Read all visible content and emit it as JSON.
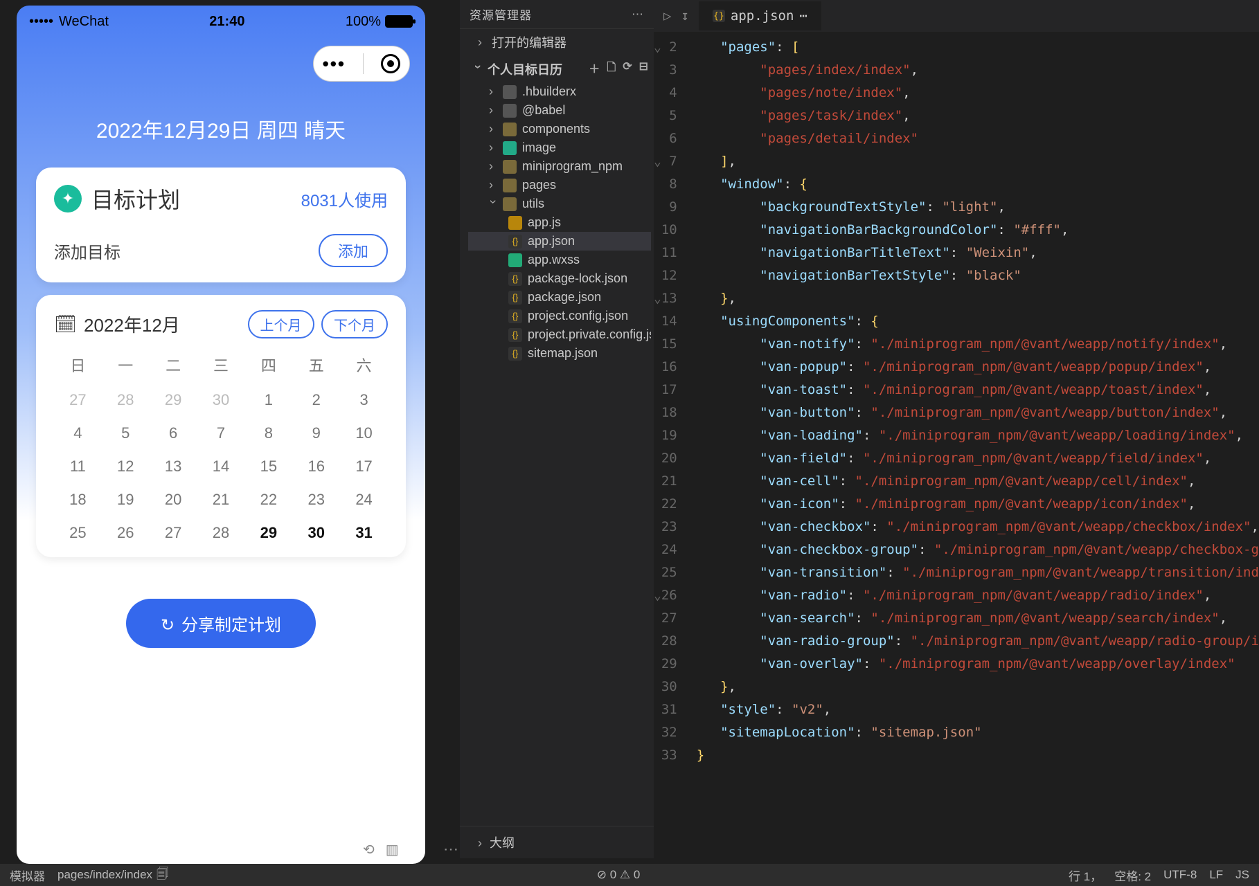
{
  "phone": {
    "status_bar": {
      "signal": "•••••",
      "carrier": "WeChat",
      "time": "21:40",
      "battery": "100%"
    },
    "capsule": {
      "dots": "•••"
    },
    "headline": "2022年12月29日 周四 晴天",
    "goal_card": {
      "title": "目标计划",
      "usage": "8031人使用",
      "add_label": "添加目标",
      "add_btn": "添加"
    },
    "calendar": {
      "title": "2022年12月",
      "prev": "上个月",
      "next": "下个月",
      "dow": [
        "日",
        "一",
        "二",
        "三",
        "四",
        "五",
        "六"
      ],
      "weeks": [
        [
          {
            "d": "27",
            "dim": true
          },
          {
            "d": "28",
            "dim": true
          },
          {
            "d": "29",
            "dim": true
          },
          {
            "d": "30",
            "dim": true
          },
          {
            "d": "1"
          },
          {
            "d": "2"
          },
          {
            "d": "3"
          }
        ],
        [
          {
            "d": "4"
          },
          {
            "d": "5"
          },
          {
            "d": "6"
          },
          {
            "d": "7"
          },
          {
            "d": "8"
          },
          {
            "d": "9"
          },
          {
            "d": "10"
          }
        ],
        [
          {
            "d": "11"
          },
          {
            "d": "12"
          },
          {
            "d": "13"
          },
          {
            "d": "14"
          },
          {
            "d": "15"
          },
          {
            "d": "16"
          },
          {
            "d": "17"
          }
        ],
        [
          {
            "d": "18"
          },
          {
            "d": "19"
          },
          {
            "d": "20"
          },
          {
            "d": "21"
          },
          {
            "d": "22"
          },
          {
            "d": "23"
          },
          {
            "d": "24"
          }
        ],
        [
          {
            "d": "25"
          },
          {
            "d": "26"
          },
          {
            "d": "27"
          },
          {
            "d": "28"
          },
          {
            "d": "29",
            "today": true
          },
          {
            "d": "30",
            "today": true
          },
          {
            "d": "31",
            "today": true
          }
        ]
      ]
    },
    "share_btn": "分享制定计划"
  },
  "explorer": {
    "title": "资源管理器",
    "open_editors": "打开的编辑器",
    "project": "个人目标日历",
    "tools": [
      "＋",
      "🗋",
      "⟳",
      "⊟"
    ],
    "tree": [
      {
        "depth": 1,
        "icon": "folder-dim",
        "chev": "closed",
        "label": ".hbuilderx"
      },
      {
        "depth": 1,
        "icon": "folder-dim",
        "chev": "closed",
        "label": "@babel"
      },
      {
        "depth": 1,
        "icon": "folder",
        "chev": "closed",
        "label": "components"
      },
      {
        "depth": 1,
        "icon": "img",
        "chev": "closed",
        "label": "image"
      },
      {
        "depth": 1,
        "icon": "folder",
        "chev": "closed",
        "label": "miniprogram_npm"
      },
      {
        "depth": 1,
        "icon": "folder",
        "chev": "closed",
        "label": "pages"
      },
      {
        "depth": 1,
        "icon": "folder",
        "chev": "open",
        "label": "utils"
      },
      {
        "depth": 2,
        "icon": "js",
        "label": "app.js"
      },
      {
        "depth": 2,
        "icon": "json",
        "label": "app.json",
        "selected": true
      },
      {
        "depth": 2,
        "icon": "wxss",
        "label": "app.wxss"
      },
      {
        "depth": 2,
        "icon": "json",
        "label": "package-lock.json"
      },
      {
        "depth": 2,
        "icon": "json",
        "label": "package.json"
      },
      {
        "depth": 2,
        "icon": "json",
        "label": "project.config.json"
      },
      {
        "depth": 2,
        "icon": "json",
        "label": "project.private.config.js..."
      },
      {
        "depth": 2,
        "icon": "json",
        "label": "sitemap.json"
      }
    ],
    "outline": "大纲"
  },
  "editor": {
    "tab": "app.json",
    "line_start": 2,
    "fold_rows": [
      2,
      7,
      13,
      26
    ],
    "lines": [
      [
        [
          "pun",
          "   "
        ],
        [
          "key",
          "\"pages\""
        ],
        [
          "pun",
          ": "
        ],
        [
          "brk",
          "["
        ]
      ],
      [
        [
          "pun",
          "        "
        ],
        [
          "path",
          "\"pages/index/index\""
        ],
        [
          "pun",
          ","
        ]
      ],
      [
        [
          "pun",
          "        "
        ],
        [
          "path",
          "\"pages/note/index\""
        ],
        [
          "pun",
          ","
        ]
      ],
      [
        [
          "pun",
          "        "
        ],
        [
          "path",
          "\"pages/task/index\""
        ],
        [
          "pun",
          ","
        ]
      ],
      [
        [
          "pun",
          "        "
        ],
        [
          "path",
          "\"pages/detail/index\""
        ]
      ],
      [
        [
          "pun",
          "   "
        ],
        [
          "brk",
          "]"
        ],
        [
          "pun",
          ","
        ]
      ],
      [
        [
          "pun",
          "   "
        ],
        [
          "key",
          "\"window\""
        ],
        [
          "pun",
          ": "
        ],
        [
          "brk",
          "{"
        ]
      ],
      [
        [
          "pun",
          "        "
        ],
        [
          "key",
          "\"backgroundTextStyle\""
        ],
        [
          "pun",
          ": "
        ],
        [
          "str",
          "\"light\""
        ],
        [
          "pun",
          ","
        ]
      ],
      [
        [
          "pun",
          "        "
        ],
        [
          "key",
          "\"navigationBarBackgroundColor\""
        ],
        [
          "pun",
          ": "
        ],
        [
          "str",
          "\"#fff\""
        ],
        [
          "pun",
          ","
        ]
      ],
      [
        [
          "pun",
          "        "
        ],
        [
          "key",
          "\"navigationBarTitleText\""
        ],
        [
          "pun",
          ": "
        ],
        [
          "str",
          "\"Weixin\""
        ],
        [
          "pun",
          ","
        ]
      ],
      [
        [
          "pun",
          "        "
        ],
        [
          "key",
          "\"navigationBarTextStyle\""
        ],
        [
          "pun",
          ": "
        ],
        [
          "str",
          "\"black\""
        ]
      ],
      [
        [
          "pun",
          "   "
        ],
        [
          "brk",
          "}"
        ],
        [
          "pun",
          ","
        ]
      ],
      [
        [
          "pun",
          "   "
        ],
        [
          "key",
          "\"usingComponents\""
        ],
        [
          "pun",
          ": "
        ],
        [
          "brk",
          "{"
        ]
      ],
      [
        [
          "pun",
          "        "
        ],
        [
          "key",
          "\"van-notify\""
        ],
        [
          "pun",
          ": "
        ],
        [
          "path",
          "\"./miniprogram_npm/@vant/weapp/notify/index\""
        ],
        [
          "pun",
          ","
        ]
      ],
      [
        [
          "pun",
          "        "
        ],
        [
          "key",
          "\"van-popup\""
        ],
        [
          "pun",
          ": "
        ],
        [
          "path",
          "\"./miniprogram_npm/@vant/weapp/popup/index\""
        ],
        [
          "pun",
          ","
        ]
      ],
      [
        [
          "pun",
          "        "
        ],
        [
          "key",
          "\"van-toast\""
        ],
        [
          "pun",
          ": "
        ],
        [
          "path",
          "\"./miniprogram_npm/@vant/weapp/toast/index\""
        ],
        [
          "pun",
          ","
        ]
      ],
      [
        [
          "pun",
          "        "
        ],
        [
          "key",
          "\"van-button\""
        ],
        [
          "pun",
          ": "
        ],
        [
          "path",
          "\"./miniprogram_npm/@vant/weapp/button/index\""
        ],
        [
          "pun",
          ","
        ]
      ],
      [
        [
          "pun",
          "        "
        ],
        [
          "key",
          "\"van-loading\""
        ],
        [
          "pun",
          ": "
        ],
        [
          "path",
          "\"./miniprogram_npm/@vant/weapp/loading/index\""
        ],
        [
          "pun",
          ","
        ]
      ],
      [
        [
          "pun",
          "        "
        ],
        [
          "key",
          "\"van-field\""
        ],
        [
          "pun",
          ": "
        ],
        [
          "path",
          "\"./miniprogram_npm/@vant/weapp/field/index\""
        ],
        [
          "pun",
          ","
        ]
      ],
      [
        [
          "pun",
          "        "
        ],
        [
          "key",
          "\"van-cell\""
        ],
        [
          "pun",
          ": "
        ],
        [
          "path",
          "\"./miniprogram_npm/@vant/weapp/cell/index\""
        ],
        [
          "pun",
          ","
        ]
      ],
      [
        [
          "pun",
          "        "
        ],
        [
          "key",
          "\"van-icon\""
        ],
        [
          "pun",
          ": "
        ],
        [
          "path",
          "\"./miniprogram_npm/@vant/weapp/icon/index\""
        ],
        [
          "pun",
          ","
        ]
      ],
      [
        [
          "pun",
          "        "
        ],
        [
          "key",
          "\"van-checkbox\""
        ],
        [
          "pun",
          ": "
        ],
        [
          "path",
          "\"./miniprogram_npm/@vant/weapp/checkbox/index\""
        ],
        [
          "pun",
          ","
        ]
      ],
      [
        [
          "pun",
          "        "
        ],
        [
          "key",
          "\"van-checkbox-group\""
        ],
        [
          "pun",
          ": "
        ],
        [
          "path",
          "\"./miniprogram_npm/@vant/weapp/checkbox-group/index\""
        ],
        [
          "pun",
          ","
        ]
      ],
      [
        [
          "pun",
          "        "
        ],
        [
          "key",
          "\"van-transition\""
        ],
        [
          "pun",
          ": "
        ],
        [
          "path",
          "\"./miniprogram_npm/@vant/weapp/transition/index\""
        ],
        [
          "pun",
          ","
        ]
      ],
      [
        [
          "pun",
          "        "
        ],
        [
          "key",
          "\"van-radio\""
        ],
        [
          "pun",
          ": "
        ],
        [
          "path",
          "\"./miniprogram_npm/@vant/weapp/radio/index\""
        ],
        [
          "pun",
          ","
        ]
      ],
      [
        [
          "pun",
          "        "
        ],
        [
          "key",
          "\"van-search\""
        ],
        [
          "pun",
          ": "
        ],
        [
          "path",
          "\"./miniprogram_npm/@vant/weapp/search/index\""
        ],
        [
          "pun",
          ","
        ]
      ],
      [
        [
          "pun",
          "        "
        ],
        [
          "key",
          "\"van-radio-group\""
        ],
        [
          "pun",
          ": "
        ],
        [
          "path",
          "\"./miniprogram_npm/@vant/weapp/radio-group/index\""
        ],
        [
          "pun",
          ","
        ]
      ],
      [
        [
          "pun",
          "        "
        ],
        [
          "key",
          "\"van-overlay\""
        ],
        [
          "pun",
          ": "
        ],
        [
          "path",
          "\"./miniprogram_npm/@vant/weapp/overlay/index\""
        ]
      ],
      [
        [
          "pun",
          "   "
        ],
        [
          "brk",
          "}"
        ],
        [
          "pun",
          ","
        ]
      ],
      [
        [
          "pun",
          "   "
        ],
        [
          "key",
          "\"style\""
        ],
        [
          "pun",
          ": "
        ],
        [
          "str",
          "\"v2\""
        ],
        [
          "pun",
          ","
        ]
      ],
      [
        [
          "pun",
          "   "
        ],
        [
          "key",
          "\"sitemapLocation\""
        ],
        [
          "pun",
          ": "
        ],
        [
          "str",
          "\"sitemap.json\""
        ]
      ],
      [
        [
          "brk",
          "}"
        ]
      ]
    ]
  },
  "status": {
    "left_tab": "pages/index/index",
    "problems": "⊘ 0  ⚠ 0",
    "pos": "行 1，",
    "col": "空格: 2",
    "enc": "UTF-8",
    "eol": "LF",
    "lang": "JS"
  },
  "sim_status_prefix": "模拟器"
}
